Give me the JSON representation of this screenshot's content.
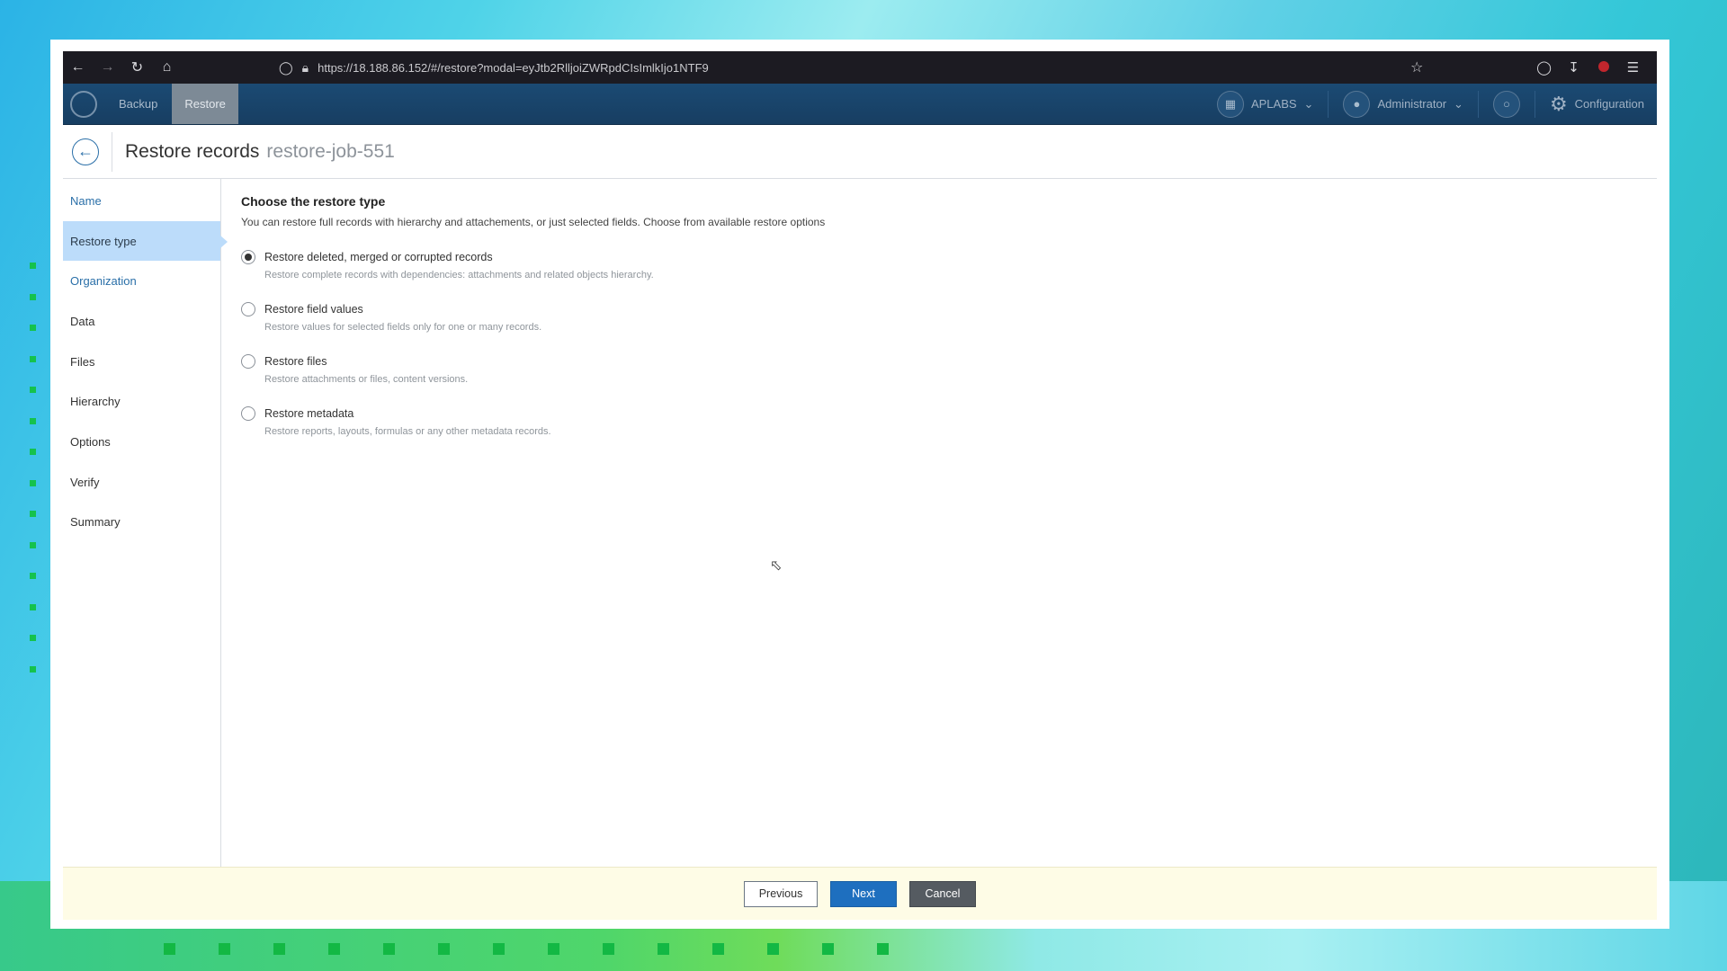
{
  "browser": {
    "url": "https://18.188.86.152/#/restore?modal=eyJtb2RlljoiZWRpdCIsImlkIjo1NTF9",
    "icons": [
      "back-arrow-icon",
      "forward-arrow-icon",
      "reload-icon",
      "home-icon",
      "shield-icon",
      "lock-icon",
      "star-icon",
      "pocket-icon",
      "download-icon",
      "ublock-icon",
      "hamburger-menu-icon"
    ]
  },
  "appbar": {
    "nav": [
      {
        "label": "Backup"
      },
      {
        "label": "Restore"
      }
    ],
    "org_label": "APLABS",
    "user_label": "Administrator",
    "config_label": "Configuration"
  },
  "page": {
    "title": "Restore records",
    "job_name": "restore-job-551"
  },
  "sidebar": {
    "items": [
      {
        "label": "Name"
      },
      {
        "label": "Restore type"
      },
      {
        "label": "Organization"
      },
      {
        "label": "Data"
      },
      {
        "label": "Files"
      },
      {
        "label": "Hierarchy"
      },
      {
        "label": "Options"
      },
      {
        "label": "Verify"
      },
      {
        "label": "Summary"
      }
    ],
    "active_index": 1
  },
  "main": {
    "heading": "Choose the restore type",
    "description": "You can restore full records with hierarchy and attachements, or just selected fields. Choose from available restore options",
    "options": [
      {
        "label": "Restore deleted, merged or corrupted records",
        "sub": "Restore complete records with dependencies: attachments and related objects hierarchy.",
        "checked": true
      },
      {
        "label": "Restore field values",
        "sub": "Restore values for selected fields only for one or many records.",
        "checked": false
      },
      {
        "label": "Restore files",
        "sub": "Restore attachments or files, content versions.",
        "checked": false
      },
      {
        "label": "Restore metadata",
        "sub": "Restore reports, layouts, formulas or any other metadata records.",
        "checked": false
      }
    ]
  },
  "footer": {
    "previous_label": "Previous",
    "next_label": "Next",
    "cancel_label": "Cancel"
  },
  "colors": {
    "header_bg": "#1b4a73",
    "active_side": "#bcdcfa",
    "link": "#2a6fa8",
    "next_btn": "#1e6fbf",
    "cancel_btn": "#555b61",
    "footer_bg": "#fefce6"
  }
}
